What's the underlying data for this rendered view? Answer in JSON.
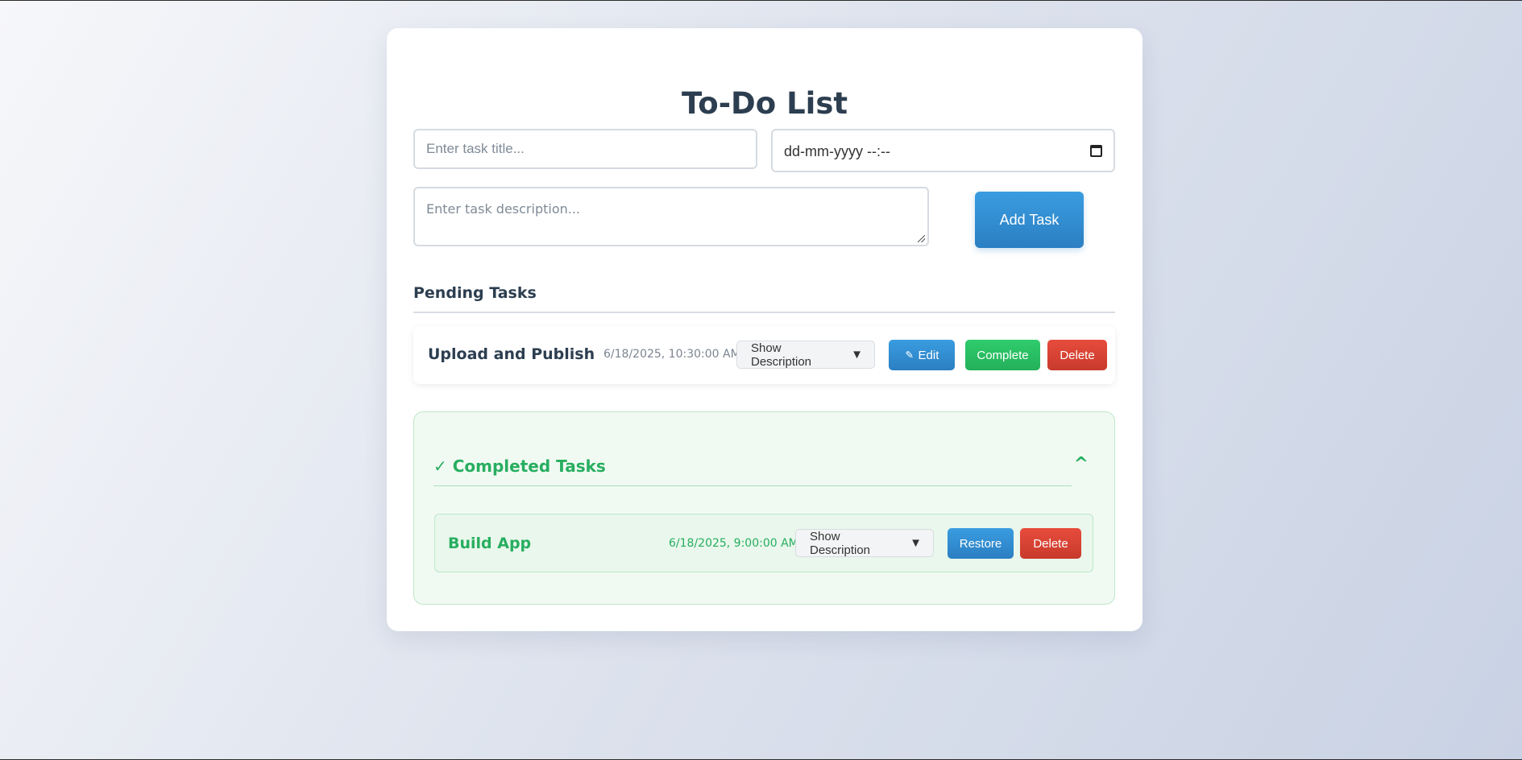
{
  "app": {
    "title": "To-Do List"
  },
  "form": {
    "title_placeholder": "Enter task title...",
    "date_value": "dd-mm-yyyy --:--",
    "description_placeholder": "Enter task description...",
    "add_button": "Add Task"
  },
  "pending": {
    "heading": "Pending Tasks",
    "tasks": [
      {
        "title": "Upload and Publish",
        "datetime": "6/18/2025, 10:30:00 AM",
        "show_description": "Show Description",
        "edit": "Edit",
        "complete": "Complete",
        "delete": "Delete"
      }
    ]
  },
  "completed": {
    "check": "✓",
    "heading": "Completed Tasks",
    "collapse": "^",
    "tasks": [
      {
        "title": "Build App",
        "datetime": "6/18/2025, 9:00:00 AM",
        "show_description": "Show Description",
        "restore": "Restore",
        "delete": "Delete"
      }
    ]
  },
  "icons": {
    "dropdown": "▼",
    "edit": "✏",
    "calendar": "calendar-icon"
  },
  "colors": {
    "primary": "#2b7fc2",
    "success": "#27ae60",
    "danger": "#e74c3c",
    "heading": "#2c3e50"
  }
}
